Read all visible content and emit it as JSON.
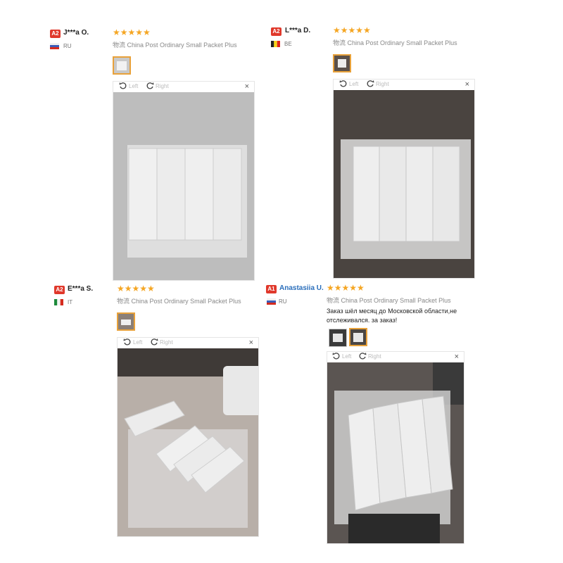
{
  "reviews": [
    {
      "badge": "A2",
      "username": "J***a O.",
      "country": "RU",
      "shipping_cn": "物流",
      "shipping": "China Post Ordinary Small Packet Plus",
      "rotate_left": "Left",
      "rotate_right": "Right",
      "close": "×",
      "stars": "★★★★★",
      "rating": 5
    },
    {
      "badge": "A2",
      "username": "L***a D.",
      "country": "BE",
      "shipping_cn": "物流",
      "shipping": "China Post Ordinary Small Packet Plus",
      "rotate_left": "Left",
      "rotate_right": "Right",
      "close": "×",
      "stars": "★★★★★",
      "rating": 5
    },
    {
      "badge": "A2",
      "username": "E***a S.",
      "country": "IT",
      "shipping_cn": "物流",
      "shipping": "China Post Ordinary Small Packet Plus",
      "rotate_left": "Left",
      "rotate_right": "Right",
      "close": "×",
      "stars": "★★★★★",
      "rating": 5
    },
    {
      "badge": "A1",
      "username": "Anastasiia U.",
      "country": "RU",
      "shipping_cn": "物流",
      "shipping": "China Post Ordinary Small Packet Plus",
      "comment": "Заказ шёл месяц до Московской области,не отслеживался. за заказ!",
      "rotate_left": "Left",
      "rotate_right": "Right",
      "close": "×",
      "stars": "★★★★★",
      "rating": 5
    }
  ],
  "colors": {
    "star": "#f5a623",
    "badge": "#e0382b",
    "selected_thumb": "#e8a13a"
  }
}
